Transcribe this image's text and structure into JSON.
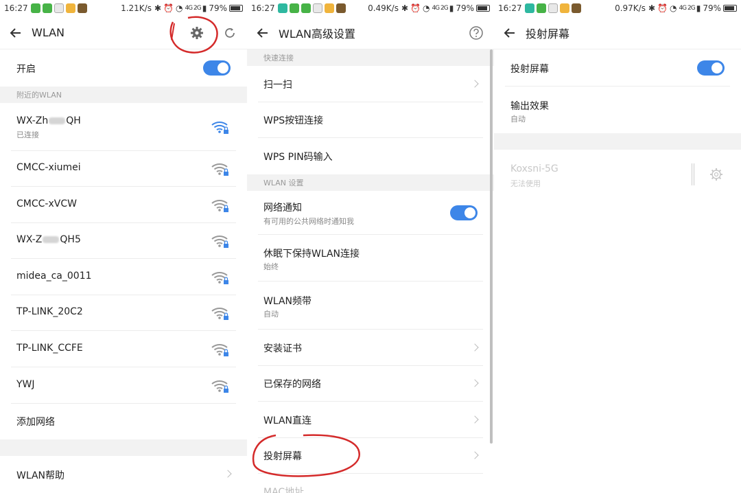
{
  "status": [
    {
      "time": "16:27",
      "speed": "1.21K/s",
      "battery": "79%",
      "net": "4G 2G"
    },
    {
      "time": "16:27",
      "speed": "0.49K/s",
      "battery": "79%",
      "net": "4G 2G"
    },
    {
      "time": "16:27",
      "speed": "0.97K/s",
      "battery": "79%",
      "net": "4G 2G"
    }
  ],
  "wlan": {
    "title": "WLAN",
    "toggle_label": "开启",
    "nearby_header": "附近的WLAN",
    "networks": [
      {
        "pre": "WX-Zh",
        "post": "QH",
        "sub": "已连接"
      },
      {
        "pre": "CMCC-xiumei",
        "post": "",
        "sub": ""
      },
      {
        "pre": "CMCC-xVCW",
        "post": "",
        "sub": ""
      },
      {
        "pre": "WX-Z",
        "post": "QH5",
        "sub": ""
      },
      {
        "pre": "midea_ca_0011",
        "post": "",
        "sub": ""
      },
      {
        "pre": "TP-LINK_20C2",
        "post": "",
        "sub": ""
      },
      {
        "pre": "TP-LINK_CCFE",
        "post": "",
        "sub": ""
      },
      {
        "pre": "YWJ",
        "post": "",
        "sub": ""
      }
    ],
    "add_network": "添加网络",
    "help": "WLAN帮助",
    "accent": "#3d86e8",
    "annotation_color": "#d42a2a"
  },
  "advanced": {
    "title": "WLAN高级设置",
    "quick_header": "快速连接",
    "scan": "扫一扫",
    "wps_button": "WPS按钮连接",
    "wps_pin": "WPS PIN码输入",
    "settings_header": "WLAN 设置",
    "notify_title": "网络通知",
    "notify_sub": "有可用的公共网络时通知我",
    "sleep_title": "休眠下保持WLAN连接",
    "sleep_sub": "始终",
    "band_title": "WLAN频带",
    "band_sub": "自动",
    "install_cert": "安装证书",
    "saved_networks": "已保存的网络",
    "wlan_direct": "WLAN直连",
    "cast_screen": "投射屏幕",
    "mac_address": "MAC地址"
  },
  "cast": {
    "title": "投射屏幕",
    "toggle_label": "投射屏幕",
    "output_title": "输出效果",
    "output_sub": "自动",
    "device_name": "Koxsni-5G",
    "device_status": "无法使用"
  }
}
